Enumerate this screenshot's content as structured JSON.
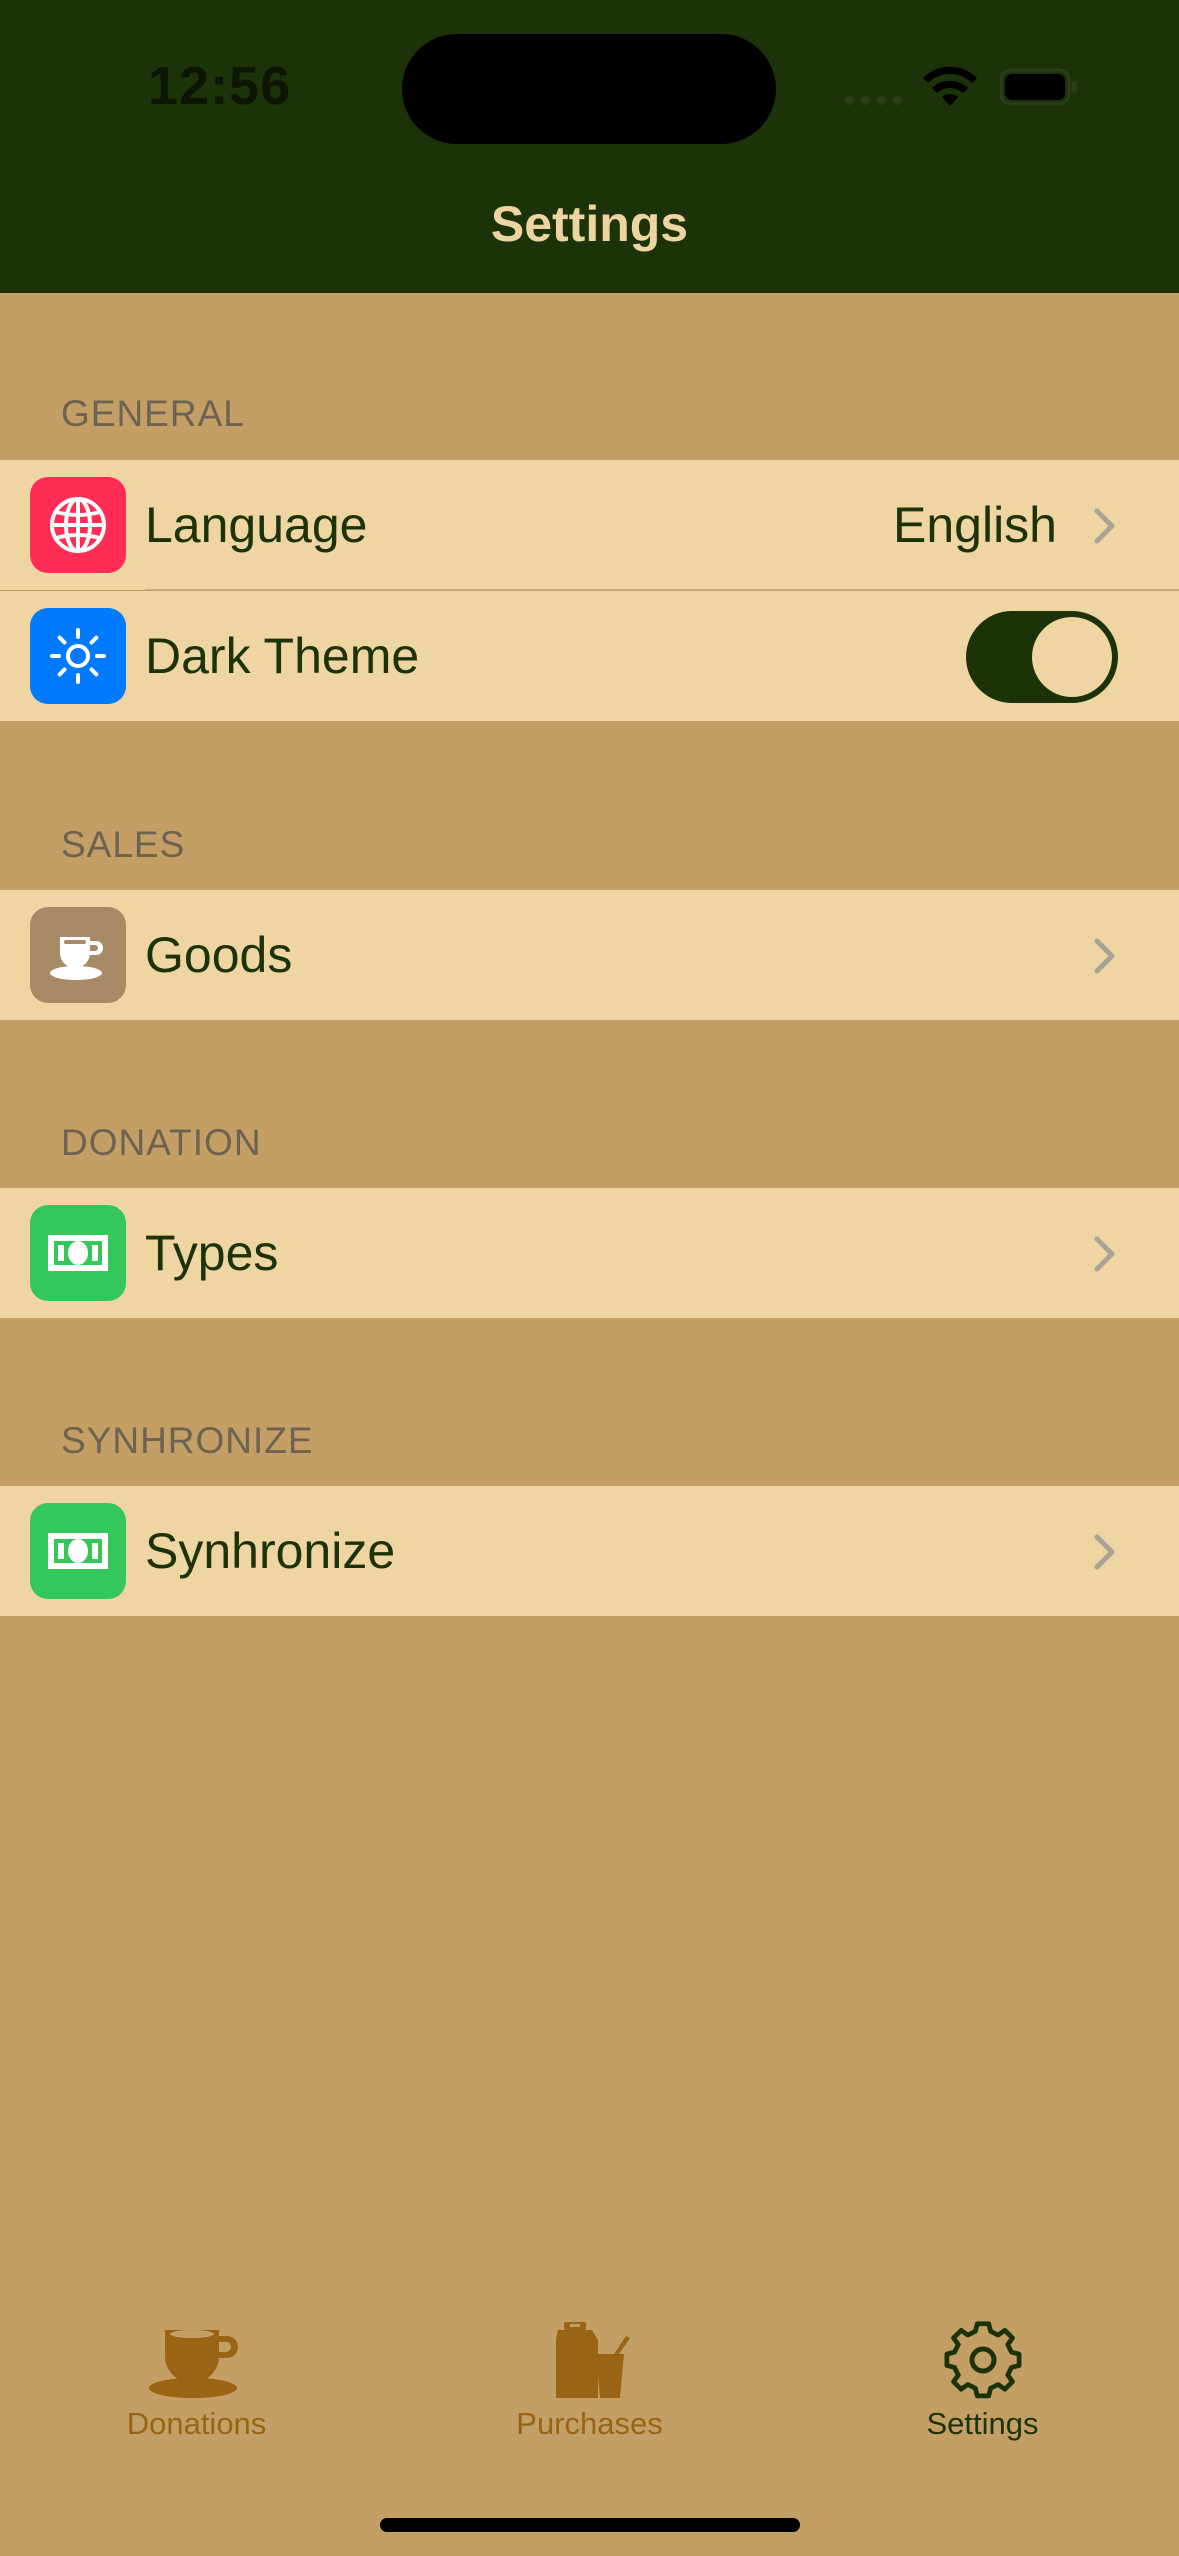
{
  "status_bar": {
    "time": "12:56"
  },
  "nav": {
    "title": "Settings"
  },
  "sections": {
    "general": {
      "header": "GENERAL",
      "language": {
        "label": "Language",
        "value": "English",
        "icon": "globe-icon"
      },
      "dark_theme": {
        "label": "Dark Theme",
        "enabled": true,
        "icon": "sun-icon"
      }
    },
    "sales": {
      "header": "SALES",
      "goods": {
        "label": "Goods",
        "icon": "cup-icon"
      }
    },
    "donation": {
      "header": "DONATION",
      "types": {
        "label": "Types",
        "icon": "banknote-icon"
      }
    },
    "synhronize": {
      "header": "SYNHRONIZE",
      "synhronize": {
        "label": "Synhronize",
        "icon": "banknote-icon"
      }
    }
  },
  "tab_bar": {
    "items": [
      {
        "label": "Donations",
        "icon": "cup-icon",
        "active": false
      },
      {
        "label": "Purchases",
        "icon": "bag-cup-icon",
        "active": false
      },
      {
        "label": "Settings",
        "icon": "gear-icon",
        "active": true
      }
    ]
  },
  "colors": {
    "header_bg": "#1C3209",
    "page_bg": "#C49F65",
    "row_bg": "#EFD5A1",
    "accent_text": "#1C3209",
    "tab_inactive": "#9A6415",
    "globe_tile": "#FF2D55",
    "sun_tile": "#007AFF",
    "cup_tile": "#A88A66",
    "banknote_tile": "#34C759"
  }
}
